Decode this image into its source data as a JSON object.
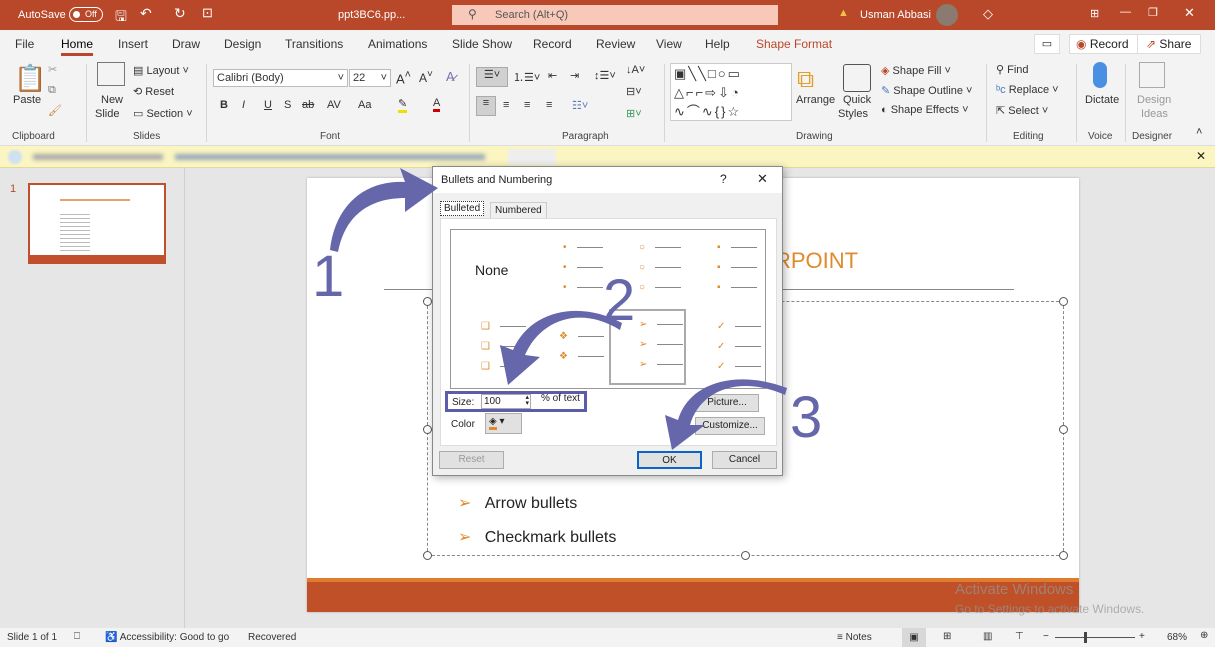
{
  "titlebar": {
    "autosave": "AutoSave",
    "autosave_state": "Off",
    "filename": "ppt3BC6.pp...",
    "search_placeholder": "Search (Alt+Q)",
    "user": "Usman Abbasi"
  },
  "tabs": [
    "File",
    "Home",
    "Insert",
    "Draw",
    "Design",
    "Transitions",
    "Animations",
    "Slide Show",
    "Record",
    "Review",
    "View",
    "Help",
    "Shape Format"
  ],
  "tab_active": "Home",
  "top_buttons": {
    "record": "Record",
    "share": "Share"
  },
  "ribbon": {
    "clipboard": {
      "paste": "Paste",
      "group": "Clipboard"
    },
    "slides": {
      "new_slide": "New",
      "new_slide2": "Slide",
      "layout": "Layout",
      "reset": "Reset",
      "section": "Section",
      "group": "Slides"
    },
    "font": {
      "font_name": "Calibri (Body)",
      "font_size": "22",
      "bold": "B",
      "italic": "I",
      "underline": "U",
      "shadow": "S",
      "strike": "ab",
      "spacing": "AV",
      "case": "Aa",
      "group": "Font"
    },
    "paragraph": {
      "group": "Paragraph"
    },
    "drawing": {
      "arrange": "Arrange",
      "quick_styles": "Quick",
      "quick_styles2": "Styles",
      "shape_fill": "Shape Fill",
      "shape_outline": "Shape Outline",
      "shape_effects": "Shape Effects",
      "group": "Drawing"
    },
    "editing": {
      "find": "Find",
      "replace": "Replace",
      "select": "Select",
      "group": "Editing"
    },
    "voice": {
      "dictate": "Dictate",
      "group": "Voice"
    },
    "designer": {
      "design_ideas": "Design",
      "design_ideas2": "Ideas",
      "group": "Designer"
    }
  },
  "thumbnail": {
    "number": "1"
  },
  "slide": {
    "title_visible": "RPOINT",
    "bullets": [
      "Arrow bullets",
      "Checkmark bullets"
    ]
  },
  "dialog": {
    "title": "Bullets and Numbering",
    "help": "?",
    "close": "✕",
    "tabs": [
      "Bulleted",
      "Numbered"
    ],
    "active_tab": "Bulleted",
    "none_label": "None",
    "size_label": "Size:",
    "size_value": "100",
    "size_unit": "% of text",
    "color_label": "Color",
    "picture": "Picture...",
    "customize": "Customize...",
    "reset": "Reset",
    "ok": "OK",
    "cancel": "Cancel",
    "bullet_color": "#e08a2c"
  },
  "annotations": [
    "1",
    "2",
    "3"
  ],
  "annotation_color": "#6666aa",
  "watermark": {
    "line1": "Activate Windows",
    "line2": "Go to Settings to activate Windows."
  },
  "status": {
    "slide": "Slide 1 of 1",
    "accessibility": "Accessibility: Good to go",
    "recovered": "Recovered",
    "notes": "Notes",
    "zoom": "68%"
  }
}
